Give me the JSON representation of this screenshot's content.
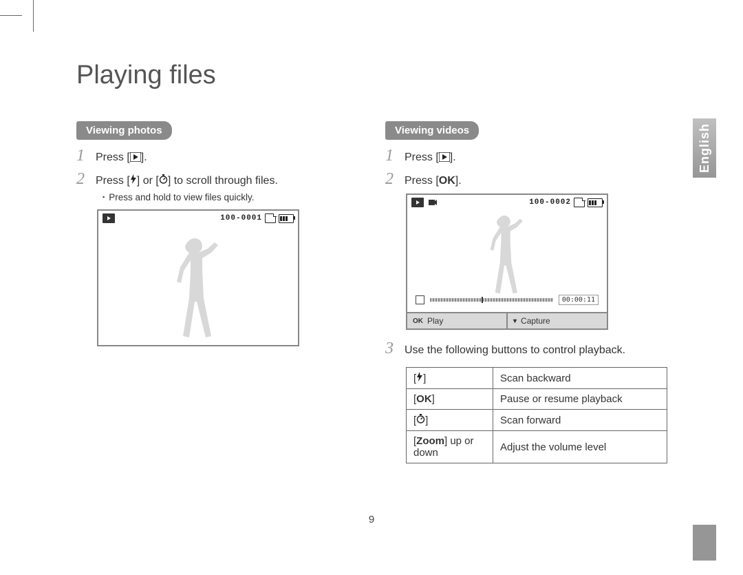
{
  "page_number": "9",
  "language_tab": "English",
  "title": "Playing files",
  "photos": {
    "heading": "Viewing photos",
    "step1": "Press [",
    "step1_suffix": "].",
    "step2_prefix": "Press [",
    "step2_mid": "] or [",
    "step2_suffix": "] to scroll through files.",
    "sub": "Press and hold to view files quickly.",
    "screen_counter": "100-0001"
  },
  "videos": {
    "heading": "Viewing videos",
    "step1": "Press [",
    "step1_suffix": "].",
    "step2_prefix": "Press [",
    "step2_suffix": "].",
    "step3": "Use the following buttons to control playback.",
    "screen_counter": "100-0002",
    "timecode": "00:00:11",
    "footer_play": "Play",
    "footer_capture": "Capture",
    "footer_ok": "OK"
  },
  "controls_table": {
    "r1_key_open": "[",
    "r1_key_close": "]",
    "r1_desc": "Scan backward",
    "r2_key_open": "[",
    "r2_key_close": "]",
    "r2_desc": "Pause or resume playback",
    "r3_key_open": "[",
    "r3_key_close": "]",
    "r3_desc": "Scan forward",
    "r4_key_open": "[",
    "r4_key_mid": "Zoom",
    "r4_key_rest": "] up or down",
    "r4_desc": "Adjust the volume level"
  },
  "glyphs": {
    "flash": "⚡",
    "timer": "⏱",
    "ok": "OK",
    "down": "▾"
  }
}
